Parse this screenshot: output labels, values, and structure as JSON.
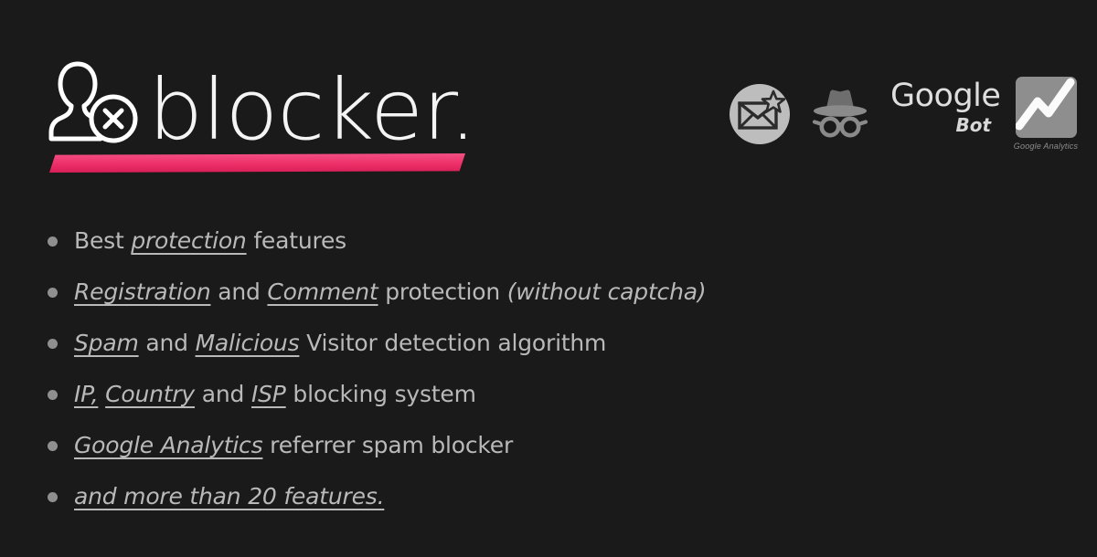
{
  "background_color": "#1a1a1a",
  "accent_color": "#ee2f68",
  "text_color": "#b9b9b9",
  "logo": {
    "wordmark": "blocker.",
    "mark_icon": "user-blocked-icon",
    "underline_icon": "accent-underline-bar"
  },
  "brand_icons": [
    {
      "name": "spam-mail-icon",
      "label": ""
    },
    {
      "name": "incognito-icon",
      "label": ""
    },
    {
      "name": "google-bot-icon",
      "label": "Google",
      "sublabel": "Bot"
    },
    {
      "name": "google-analytics-icon",
      "label": "Google Analytics"
    }
  ],
  "features": [
    {
      "bullet": "bullet-icon",
      "parts": [
        {
          "text": "Best ",
          "style": "plain"
        },
        {
          "text": "protection",
          "style": "em"
        },
        {
          "text": " features",
          "style": "plain"
        }
      ]
    },
    {
      "bullet": "bullet-icon",
      "parts": [
        {
          "text": "Registration",
          "style": "em"
        },
        {
          "text": " and ",
          "style": "plain"
        },
        {
          "text": "Comment",
          "style": "em"
        },
        {
          "text": " protection ",
          "style": "plain"
        },
        {
          "text": "(without captcha)",
          "style": "it"
        }
      ]
    },
    {
      "bullet": "bullet-icon",
      "parts": [
        {
          "text": "Spam",
          "style": "em"
        },
        {
          "text": " and ",
          "style": "plain"
        },
        {
          "text": "Malicious",
          "style": "em"
        },
        {
          "text": " Visitor detection algorithm",
          "style": "plain"
        }
      ]
    },
    {
      "bullet": "bullet-icon",
      "parts": [
        {
          "text": "IP,",
          "style": "em"
        },
        {
          "text": " ",
          "style": "plain"
        },
        {
          "text": "Country",
          "style": "em"
        },
        {
          "text": " and ",
          "style": "plain"
        },
        {
          "text": "ISP",
          "style": "em"
        },
        {
          "text": " blocking system",
          "style": "plain"
        }
      ]
    },
    {
      "bullet": "bullet-icon",
      "parts": [
        {
          "text": "Google Analytics",
          "style": "em"
        },
        {
          "text": " referrer spam blocker",
          "style": "plain"
        }
      ]
    },
    {
      "bullet": "bullet-icon",
      "parts": [
        {
          "text": "and more than 20 features.",
          "style": "em"
        }
      ]
    }
  ]
}
